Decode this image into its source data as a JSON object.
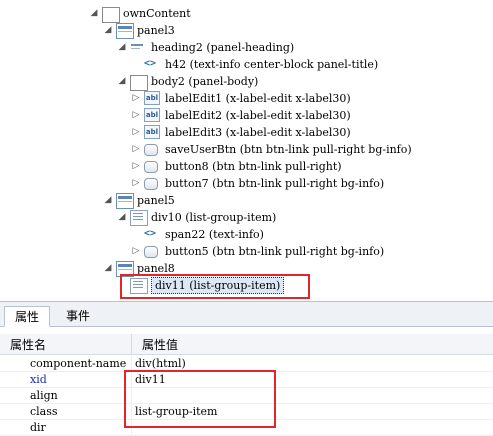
{
  "tree": {
    "rows": [
      {
        "label": "ownContent",
        "icon": "box-icon",
        "expanded": true
      },
      {
        "label": "panel3",
        "icon": "panel-icon",
        "expanded": true
      },
      {
        "label": "heading2 (panel-heading)",
        "icon": "heading-icon",
        "expanded": true
      },
      {
        "label": "h42 (text-info center-block panel-title)",
        "icon": "code-tag-icon"
      },
      {
        "label": "body2 (panel-body)",
        "icon": "box-icon",
        "expanded": true
      },
      {
        "label": "labelEdit1 (x-label-edit x-label30)",
        "icon": "label-edit-icon",
        "expanded": false
      },
      {
        "label": "labelEdit2 (x-label-edit x-label30)",
        "icon": "label-edit-icon",
        "expanded": false
      },
      {
        "label": "labelEdit3 (x-label-edit x-label30)",
        "icon": "label-edit-icon",
        "expanded": false
      },
      {
        "label": "saveUserBtn (btn btn-link pull-right bg-info)",
        "icon": "button-icon",
        "expanded": false
      },
      {
        "label": "button8 (btn btn-link pull-right)",
        "icon": "button-icon",
        "expanded": false
      },
      {
        "label": "button7 (btn btn-link pull-right bg-info)",
        "icon": "button-icon",
        "expanded": false
      },
      {
        "label": "panel5",
        "icon": "panel-icon",
        "expanded": true
      },
      {
        "label": "div10 (list-group-item)",
        "icon": "list-group-icon",
        "expanded": true
      },
      {
        "label": "span22 (text-info)",
        "icon": "code-tag-icon"
      },
      {
        "label": "button5 (btn btn-link pull-right bg-info)",
        "icon": "button-icon",
        "expanded": false
      },
      {
        "label": "panel8",
        "icon": "panel-icon",
        "expanded": true
      },
      {
        "label": "div11 (list-group-item)",
        "icon": "list-group-icon",
        "selected": true
      }
    ]
  },
  "tabs": [
    {
      "label": "属性",
      "active": true
    },
    {
      "label": "事件",
      "active": false
    }
  ],
  "properties": {
    "header_name": "属性名",
    "header_value": "属性值",
    "rows": [
      {
        "name": "component-name",
        "value": "div(html)",
        "highlight_name": false
      },
      {
        "name": "xid",
        "value": "div11",
        "highlight_name": true
      },
      {
        "name": "align",
        "value": "",
        "highlight_name": false
      },
      {
        "name": "class",
        "value": "list-group-item",
        "highlight_name": false
      },
      {
        "name": "dir",
        "value": "",
        "highlight_name": false
      }
    ]
  },
  "colors": {
    "highlight_border": "#e0252d",
    "selection_bg": "#dde8f6",
    "blue_property_name": "#1b2fa8"
  }
}
